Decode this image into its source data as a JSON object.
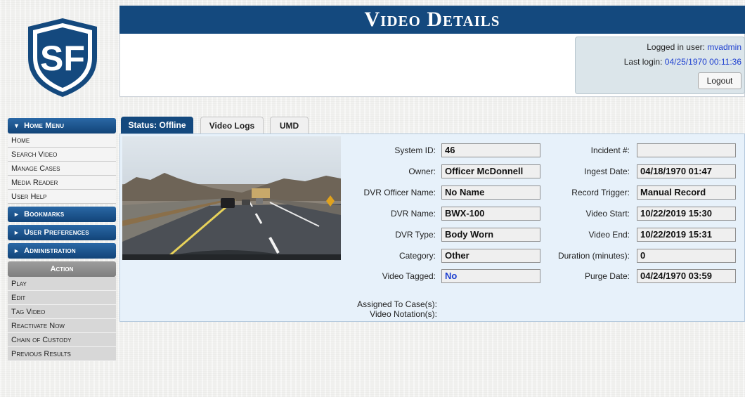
{
  "header": {
    "title": "Video Details",
    "logo_text": "SF",
    "logged_in_label": "Logged in user:",
    "logged_in_user": "mvadmin",
    "last_login_label": "Last login:",
    "last_login_value": "04/25/1970 00:11:36",
    "logout_label": "Logout"
  },
  "sidebar": {
    "home_menu": {
      "label": "Home Menu",
      "items": [
        "Home",
        "Search Video",
        "Manage Cases",
        "Media Reader",
        "User Help"
      ]
    },
    "bookmarks_label": "Bookmarks",
    "user_preferences_label": "User Preferences",
    "administration_label": "Administration",
    "action": {
      "label": "Action",
      "items": [
        "Play",
        "Edit",
        "Tag Video",
        "Reactivate Now",
        "Chain of Custody",
        "Previous Results"
      ]
    }
  },
  "tabs": [
    "Status: Offline",
    "Video Logs",
    "UMD"
  ],
  "details": {
    "left": [
      {
        "label": "System ID:",
        "value": "46"
      },
      {
        "label": "Owner:",
        "value": "Officer McDonnell"
      },
      {
        "label": "DVR Officer Name:",
        "value": "No Name"
      },
      {
        "label": "DVR Name:",
        "value": "BWX-100"
      },
      {
        "label": "DVR Type:",
        "value": "Body Worn"
      },
      {
        "label": "Category:",
        "value": "Other"
      },
      {
        "label": "Video Tagged:",
        "value": "No"
      }
    ],
    "right": [
      {
        "label": "Incident #:",
        "value": ""
      },
      {
        "label": "Ingest Date:",
        "value": "04/18/1970 01:47"
      },
      {
        "label": "Record Trigger:",
        "value": "Manual Record"
      },
      {
        "label": "Video Start:",
        "value": "10/22/2019 15:30"
      },
      {
        "label": "Video End:",
        "value": "10/22/2019 15:31"
      },
      {
        "label": "Duration (minutes):",
        "value": "0"
      },
      {
        "label": "Purge Date:",
        "value": "04/24/1970 03:59"
      }
    ],
    "assigned_label": "Assigned To Case(s):",
    "notation_label": "Video Notation(s):"
  },
  "colors": {
    "brand_navy": "#14497e",
    "link_blue": "#1d3fd0",
    "panel_blue": "#e7f1fa"
  }
}
